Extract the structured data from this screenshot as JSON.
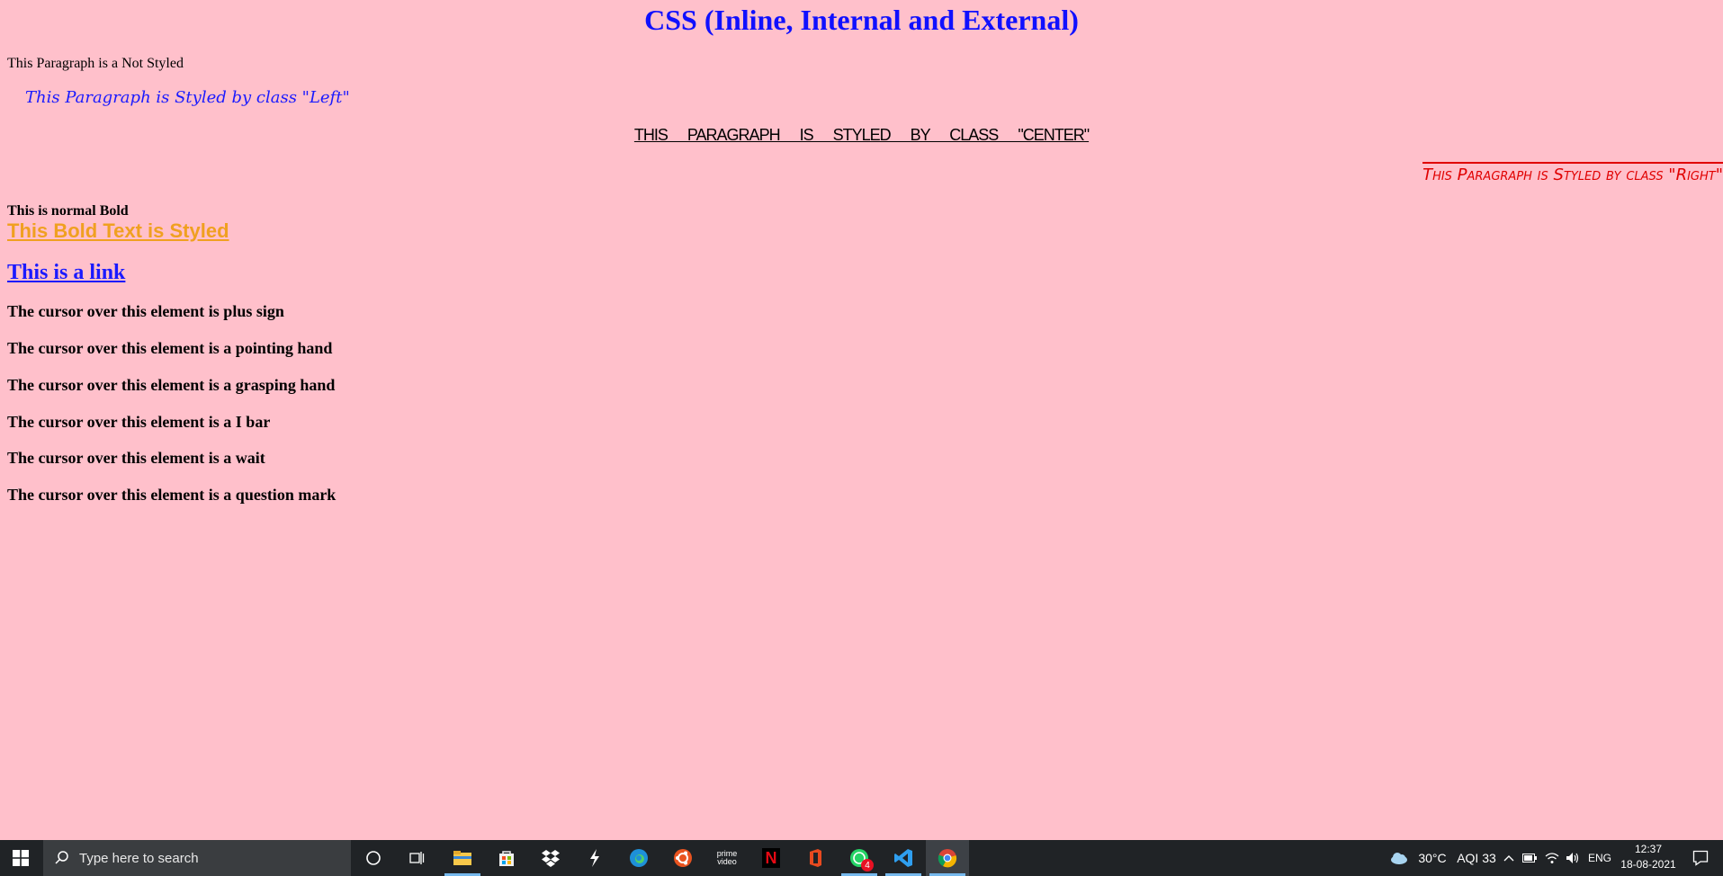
{
  "page": {
    "title": "CSS (Inline, Internal and External)",
    "p_plain": "This Paragraph is a Not Styled",
    "p_left": "This Paragraph is Styled by class \"Left\"",
    "p_center": "THIS PARAGRAPH IS STYLED BY CLASS \"CENTER\"",
    "p_right": "This Paragraph is Styled by class \"Right\"",
    "bold_normal": "This is normal Bold",
    "bold_styled": "This Bold Text is Styled",
    "link": "This is a link",
    "cursor_lines": [
      "The cursor over this element is plus sign",
      "The cursor over this element is a pointing hand",
      "The cursor over this element is a grasping hand",
      "The cursor over this element is a I bar",
      "The cursor over this element is a wait",
      "The cursor over this element is a question mark"
    ]
  },
  "colors": {
    "background": "#ffc0cb",
    "title": "#1010ff",
    "left": "#1a1aff",
    "right": "#e00000",
    "bold_styled": "#f0a020"
  },
  "taskbar": {
    "search_placeholder": "Type here to search",
    "apps": [
      "cortana-icon",
      "task-view-icon",
      "file-explorer-icon",
      "store-icon",
      "dropbox-icon",
      "app-s-icon",
      "edge-icon",
      "ubuntu-icon",
      "prime-video-icon",
      "netflix-icon",
      "office-icon",
      "whatsapp-icon",
      "vscode-icon",
      "chrome-icon"
    ],
    "prime_label": "prime video",
    "netflix_label": "N",
    "whatsapp_badge": "4",
    "weather": "30°C",
    "aqi": "AQI 33",
    "language": "ENG",
    "time": "12:37",
    "date": "18-08-2021"
  }
}
